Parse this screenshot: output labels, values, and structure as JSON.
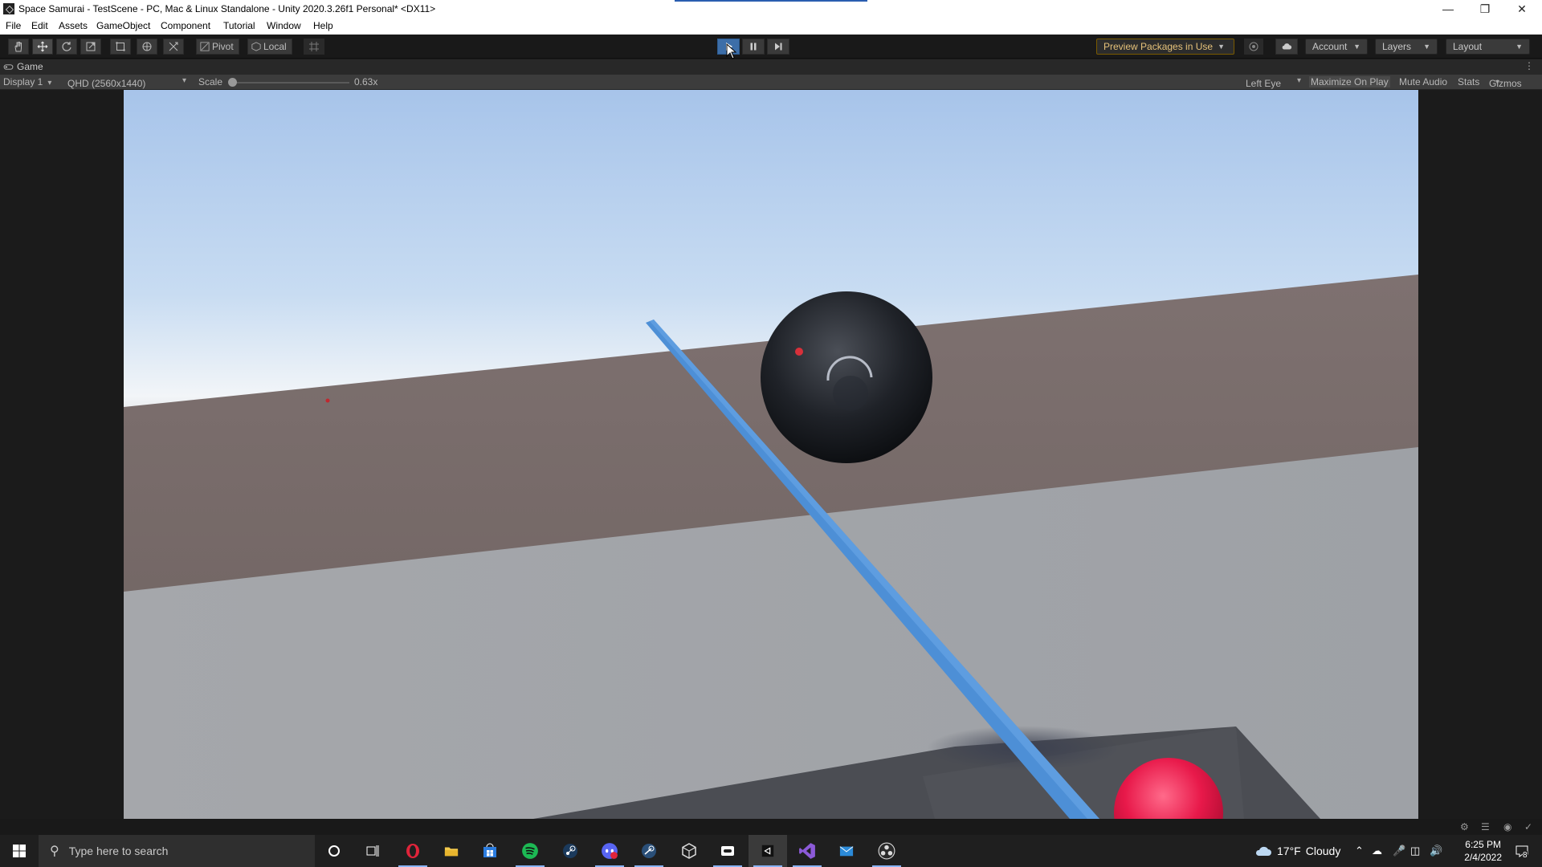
{
  "window": {
    "title": "Space Samurai - TestScene - PC, Mac & Linux Standalone - Unity 2020.3.26f1 Personal* <DX11>"
  },
  "menu": [
    "File",
    "Edit",
    "Assets",
    "GameObject",
    "Component",
    "Tutorial",
    "Window",
    "Help"
  ],
  "toolbar": {
    "pivot": "Pivot",
    "local": "Local",
    "preview_packages": "Preview Packages in Use",
    "account": "Account",
    "layers": "Layers",
    "layout": "Layout"
  },
  "game_tab": {
    "label": "Game"
  },
  "game_bar": {
    "display": "Display 1",
    "resolution": "QHD (2560x1440)",
    "scale_label": "Scale",
    "scale_value": "0.63x",
    "eye": "Left Eye",
    "maximize": "Maximize On Play",
    "mute": "Mute Audio",
    "stats": "Stats",
    "gizmos": "Gizmos"
  },
  "taskbar": {
    "search_placeholder": "Type here to search",
    "weather_temp": "17°F",
    "weather_cond": "Cloudy",
    "time": "6:25 PM",
    "date": "2/4/2022",
    "notifications": "8"
  },
  "colors": {
    "play_active": "#3d6ea8",
    "preview_border": "#7a5a00",
    "editor_bg": "#191919"
  },
  "icons": [
    "hand-icon",
    "move-icon",
    "rotate-icon",
    "scale-icon",
    "rect-icon",
    "transform-icon",
    "custom-tool-icon",
    "grid-snap-icon",
    "play-icon",
    "pause-icon",
    "step-icon",
    "collab-icon",
    "cloud-icon",
    "windows-start-icon",
    "search-icon",
    "cortana-icon",
    "task-view-icon",
    "opera-icon",
    "file-explorer-icon",
    "store-icon",
    "spotify-icon",
    "steam-icon",
    "discord-icon",
    "steam-vr-icon",
    "unity-hub-icon",
    "oculus-icon",
    "unity-icon",
    "visual-studio-icon",
    "mail-icon",
    "obs-icon"
  ]
}
